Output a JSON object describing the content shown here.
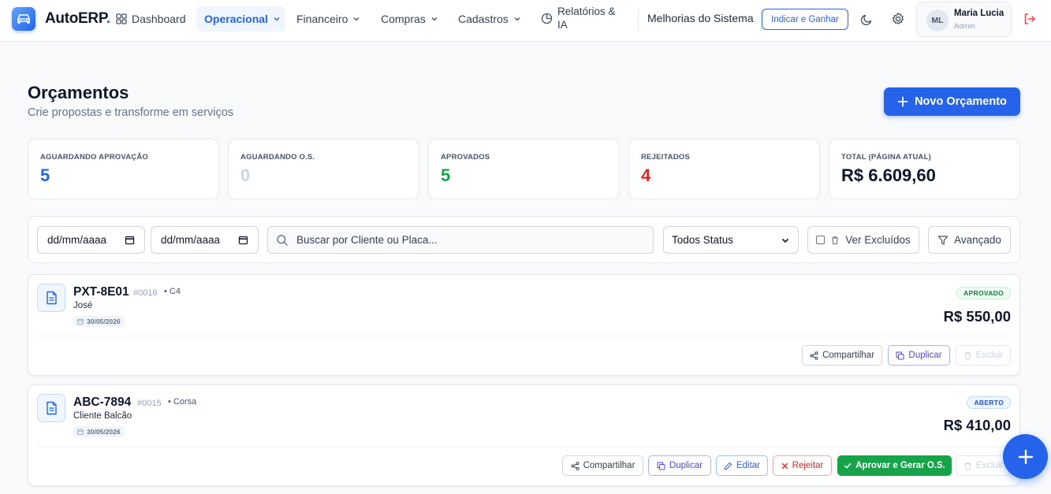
{
  "nav": {
    "brand": "AutoERP",
    "brand_dot": ".",
    "dashboard": "Dashboard",
    "operacional": "Operacional",
    "financeiro": "Financeiro",
    "compras": "Compras",
    "cadastros": "Cadastros",
    "relatorios_line1": "Relatórios &",
    "relatorios_line2": "IA",
    "melhorias": "Melhorias do Sistema",
    "indicar": "Indicar e Ganhar",
    "user": {
      "initials": "ML",
      "name": "Maria Lucia",
      "role": "Admin"
    }
  },
  "header": {
    "title": "Orçamentos",
    "subtitle": "Crie propostas e transforme em serviços",
    "new_button": "Novo Orçamento"
  },
  "stats": [
    {
      "label": "AGUARDANDO APROVAÇÃO",
      "value": "5",
      "color": "#2563eb"
    },
    {
      "label": "AGUARDANDO O.S.",
      "value": "0",
      "color": "#cbd5e1"
    },
    {
      "label": "APROVADOS",
      "value": "5",
      "color": "#16a34a"
    },
    {
      "label": "REJEITADOS",
      "value": "4",
      "color": "#dc2626"
    },
    {
      "label": "TOTAL (PÁGINA ATUAL)",
      "value": "R$ 6.609,60",
      "color": "#0f172a"
    }
  ],
  "filters": {
    "date_from": "dd/mm/aaaa",
    "date_to": "dd/mm/aaaa",
    "search_placeholder": "Buscar por Cliente ou Placa...",
    "status_selected": "Todos Status",
    "ver_excluidos": "Ver Excluídos",
    "avancado": "Avançado"
  },
  "quotes": [
    {
      "plate": "PXT-8E01",
      "number": "#0016",
      "model": "• C4",
      "client": "José",
      "date": "30/05/2026",
      "status": "APROVADO",
      "status_color": "green",
      "total": "R$ 550,00",
      "actions": {
        "compartilhar": "Compartilhar",
        "duplicar": "Duplicar",
        "excluir": "Excluir"
      }
    },
    {
      "plate": "ABC-7894",
      "number": "#0015",
      "model": "• Corsa",
      "client": "Cliente Balcão",
      "date": "30/05/2026",
      "status": "ABERTO",
      "status_color": "blue",
      "total": "R$ 410,00",
      "actions": {
        "compartilhar": "Compartilhar",
        "duplicar": "Duplicar",
        "editar": "Editar",
        "rejeitar": "Rejeitar",
        "aprovar": "Aprovar e Gerar O.S.",
        "excluir": "Excluir"
      }
    }
  ]
}
